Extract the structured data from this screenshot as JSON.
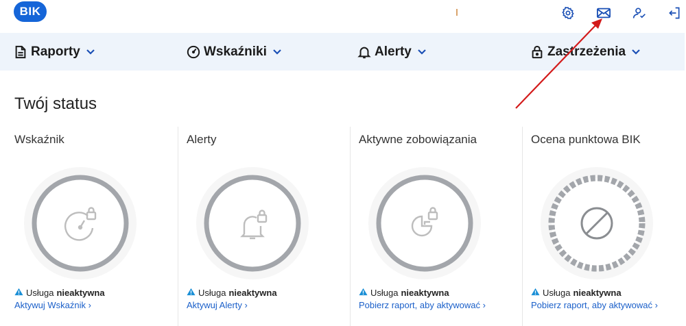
{
  "header": {
    "logo_text": "BIK",
    "icons": [
      "settings-icon",
      "mail-icon",
      "user-icon",
      "logout-icon"
    ]
  },
  "nav": {
    "items": [
      {
        "label": "Raporty",
        "icon": "document-icon"
      },
      {
        "label": "Wskaźniki",
        "icon": "gauge-icon"
      },
      {
        "label": "Alerty",
        "icon": "bell-icon"
      },
      {
        "label": "Zastrzeżenia",
        "icon": "lock-icon"
      }
    ]
  },
  "status": {
    "title": "Twój status",
    "cards": [
      {
        "title": "Wskaźnik",
        "status_prefix": "Usługa",
        "status_value": "nieaktywna",
        "link": "Aktywuj Wskaźnik ›"
      },
      {
        "title": "Alerty",
        "status_prefix": "Usługa",
        "status_value": "nieaktywna",
        "link": "Aktywuj Alerty ›"
      },
      {
        "title": "Aktywne zobowiązania",
        "status_prefix": "Usługa",
        "status_value": "nieaktywna",
        "link": "Pobierz raport, aby aktywować ›"
      },
      {
        "title": "Ocena punktowa BIK",
        "status_prefix": "Usługa",
        "status_value": "nieaktywna",
        "link": "Pobierz raport, aby aktywować ›"
      }
    ]
  },
  "colors": {
    "brand": "#1565d8",
    "link": "#1a5fc9",
    "nav_bg": "#eef4fb",
    "circle_ring": "#a3a6ab",
    "warning": "#1a8fd6",
    "annotation_arrow": "#d31a1a"
  }
}
